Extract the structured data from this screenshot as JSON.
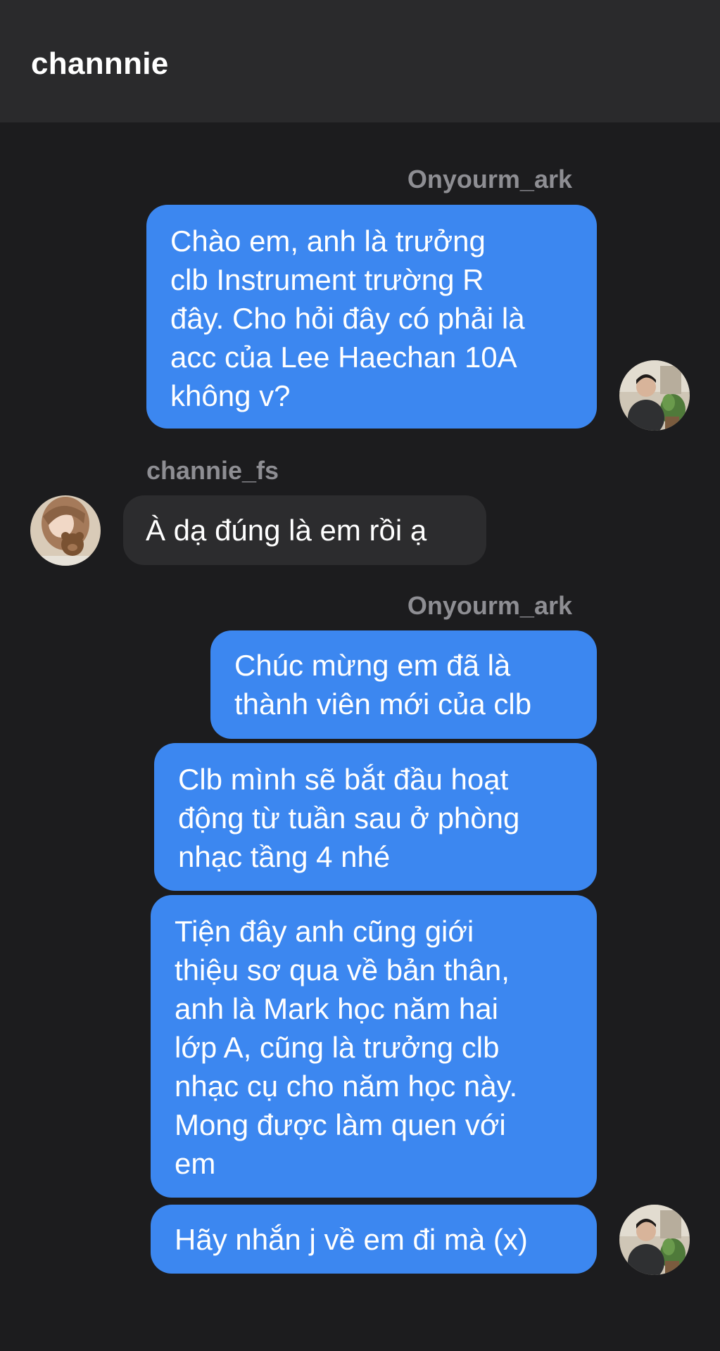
{
  "header": {
    "title": "channnie"
  },
  "conversation": {
    "groups": [
      {
        "sender": "Onyourm_ark",
        "messages": [
          "Chào em, anh là trưởng\nclb Instrument trường R\nđây. Cho hỏi đây có phải là\nacc của Lee Haechan 10A\nkhông v?"
        ],
        "avatar": "boy-with-plant-avatar"
      },
      {
        "sender": "channie_fs",
        "messages": [
          "À dạ đúng là em rồi ạ"
        ],
        "avatar": "girl-with-teddy-bear-avatar"
      },
      {
        "sender": "Onyourm_ark",
        "messages": [
          "Chúc mừng em đã là\nthành viên mới của clb",
          "Clb mình sẽ bắt đầu hoạt\nđộng từ tuần sau ở phòng\nnhạc tầng 4 nhé",
          "Tiện đây anh cũng giới\nthiệu sơ qua về bản thân,\nanh là Mark học năm hai\nlớp A, cũng là trưởng clb\nnhạc cụ cho năm học này.\nMong được làm quen với\nem",
          "Hãy nhắn j về em đi mà (x)"
        ],
        "avatar": "boy-with-plant-avatar"
      }
    ]
  },
  "colors": {
    "background": "#1c1c1e",
    "header": "#2a2a2c",
    "outgoing_bubble": "#3c87f0",
    "incoming_bubble": "#2c2c2e",
    "sender_label": "#8e8e93"
  }
}
